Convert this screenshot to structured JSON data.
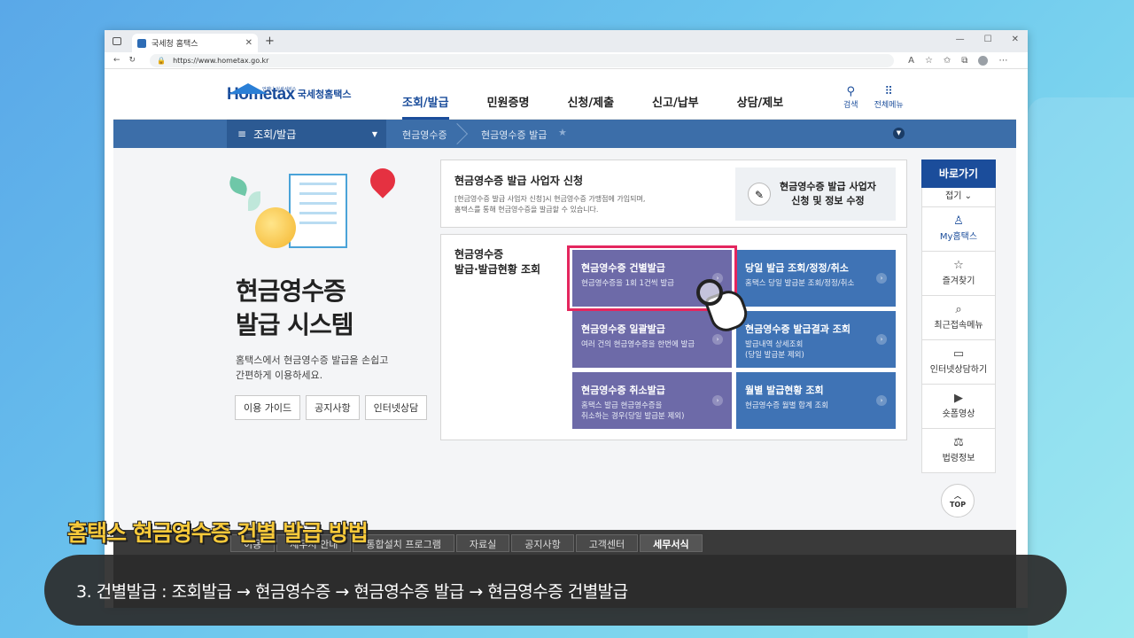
{
  "browser": {
    "tab_title": "국세청 홈택스",
    "url": "https://www.hometax.go.kr"
  },
  "header": {
    "logo_en": "Hometax",
    "logo_kr": "국세청홈택스",
    "logo_tag": "언제나 실세서비스",
    "menu": [
      "조회/발급",
      "민원증명",
      "신청/제출",
      "신고/납부",
      "상담/제보"
    ],
    "search_label": "검색",
    "allmenu_label": "전체메뉴"
  },
  "subnav": {
    "menu_label": "조회/발급",
    "crumbs": [
      "현금영수증",
      "현금영수증 발급"
    ]
  },
  "hero": {
    "title_line1": "현금영수증",
    "title_line2": "발급 시스템",
    "desc_line1": "홈택스에서 현금영수증 발급을 손쉽고",
    "desc_line2": "간편하게 이용하세요.",
    "buttons": [
      "이용 가이드",
      "공지사항",
      "인터넷상담"
    ]
  },
  "apply_card": {
    "title": "현금영수증 발급 사업자 신청",
    "desc_line1": "[현금영수증 발급 사업자 신청]시 현금영수증 가맹점에 가입되며,",
    "desc_line2": "홈택스를 통해 현금영수증을 발급할 수 있습니다.",
    "side_line1": "현금영수증 발급 사업자",
    "side_line2": "신청 및 정보 수정"
  },
  "issue_card": {
    "title_line1": "현금영수증",
    "title_line2": "발급·발급현황 조회",
    "tiles": [
      {
        "title": "현금영수증 건별발급",
        "desc1": "현금영수증을 1회 1건씩 발급",
        "desc2": ""
      },
      {
        "title": "당일 발급 조회/정정/취소",
        "desc1": "홈택스 당일 발급분 조회/정정/취소",
        "desc2": ""
      },
      {
        "title": "현금영수증 일괄발급",
        "desc1": "여러 건의 현금영수증을 한번에 발급",
        "desc2": ""
      },
      {
        "title": "현금영수증 발급결과 조회",
        "desc1": "발급내역 상세조회",
        "desc2": "(당일 발급분 제외)"
      },
      {
        "title": "현금영수증 취소발급",
        "desc1": "홈택스 발급 현금영수증을",
        "desc2": "취소하는 경우(당일 발급분 제외)"
      },
      {
        "title": "월별 발급현황 조회",
        "desc1": "현금영수증 월별 합계 조회",
        "desc2": ""
      }
    ]
  },
  "quick": {
    "title": "바로가기",
    "fold": "접기",
    "items": [
      "My홈택스",
      "즐겨찾기",
      "최근접속메뉴",
      "인터넷상담하기",
      "숏폼영상",
      "법령정보"
    ],
    "top": "TOP"
  },
  "footer": {
    "links": [
      "이용",
      "세무서 안내",
      "통합설치 프로그램",
      "자료실",
      "공지사항",
      "고객센터",
      "세무서식"
    ]
  },
  "caption": {
    "title": "홈택스 현금영수증 건별 발급 방법",
    "text": "3. 건별발급 : 조회발급 → 현금영수증 → 현금영수증 발급 → 현금영수증 건별발급"
  }
}
